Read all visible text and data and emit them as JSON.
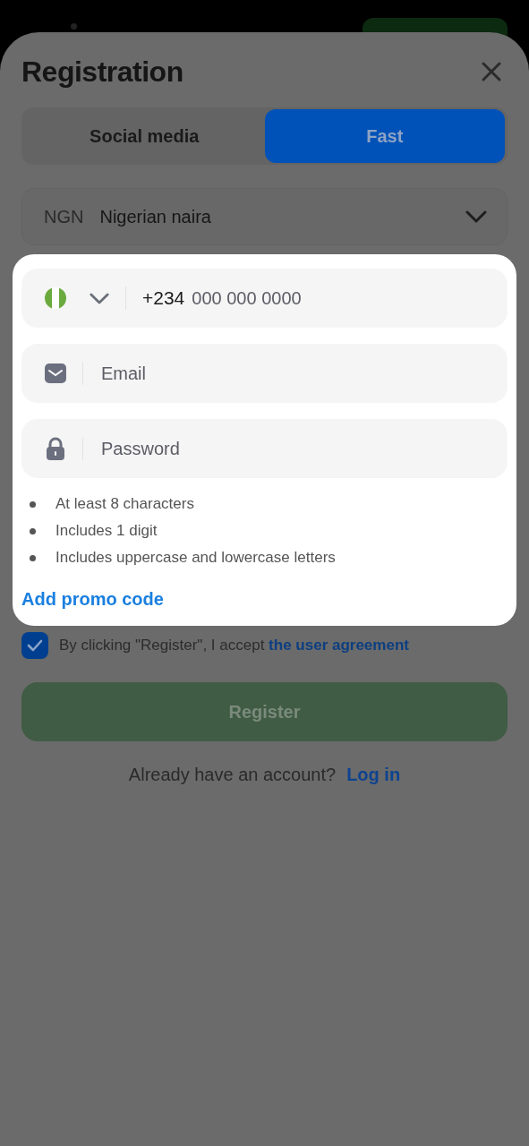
{
  "title": "Registration",
  "tabs": [
    {
      "label": "Social media",
      "selected": false
    },
    {
      "label": "Fast",
      "selected": true
    }
  ],
  "currency": {
    "code": "NGN",
    "name": "Nigerian naira"
  },
  "phone": {
    "prefix": "+234",
    "placeholder": "000 000 0000"
  },
  "email": {
    "placeholder": "Email"
  },
  "password": {
    "placeholder": "Password"
  },
  "password_rules": [
    "At least 8 characters",
    "Includes 1 digit",
    "Includes uppercase and lowercase letters"
  ],
  "promo_link": "Add promo code",
  "agreement": {
    "checked": true,
    "text": "By clicking \"Register\", I accept ",
    "link": "the user agreement"
  },
  "register_button": {
    "label": "Register",
    "disabled": true
  },
  "login_prompt": {
    "text": "Already have an account?",
    "link": "Log in"
  }
}
